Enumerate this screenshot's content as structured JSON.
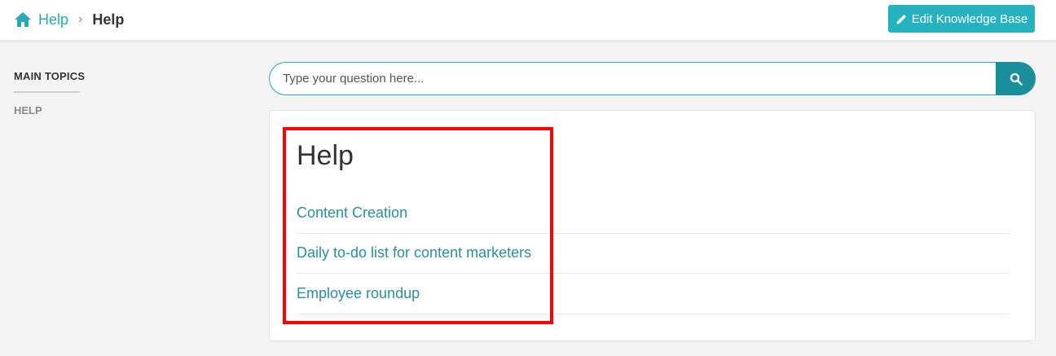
{
  "breadcrumb": {
    "home_icon": "home-icon",
    "link_label": "Help",
    "separator": "›",
    "current_label": "Help"
  },
  "header": {
    "edit_button_icon": "pencil-icon",
    "edit_button_label": "Edit Knowledge Base"
  },
  "sidebar": {
    "heading": "MAIN TOPICS",
    "items": [
      {
        "label": "HELP"
      }
    ]
  },
  "search": {
    "placeholder": "Type your question here...",
    "value": "",
    "button_icon": "search-icon"
  },
  "content": {
    "title": "Help",
    "articles": [
      {
        "label": "Content Creation"
      },
      {
        "label": "Daily to-do list for content marketers"
      },
      {
        "label": "Employee roundup"
      }
    ]
  },
  "colors": {
    "accent": "#2aa8b6",
    "button": "#26b3c1",
    "search_button": "#1a8f9c",
    "link": "#2a8f9e",
    "highlight": "#ff0000",
    "background": "#f4f4f4"
  }
}
